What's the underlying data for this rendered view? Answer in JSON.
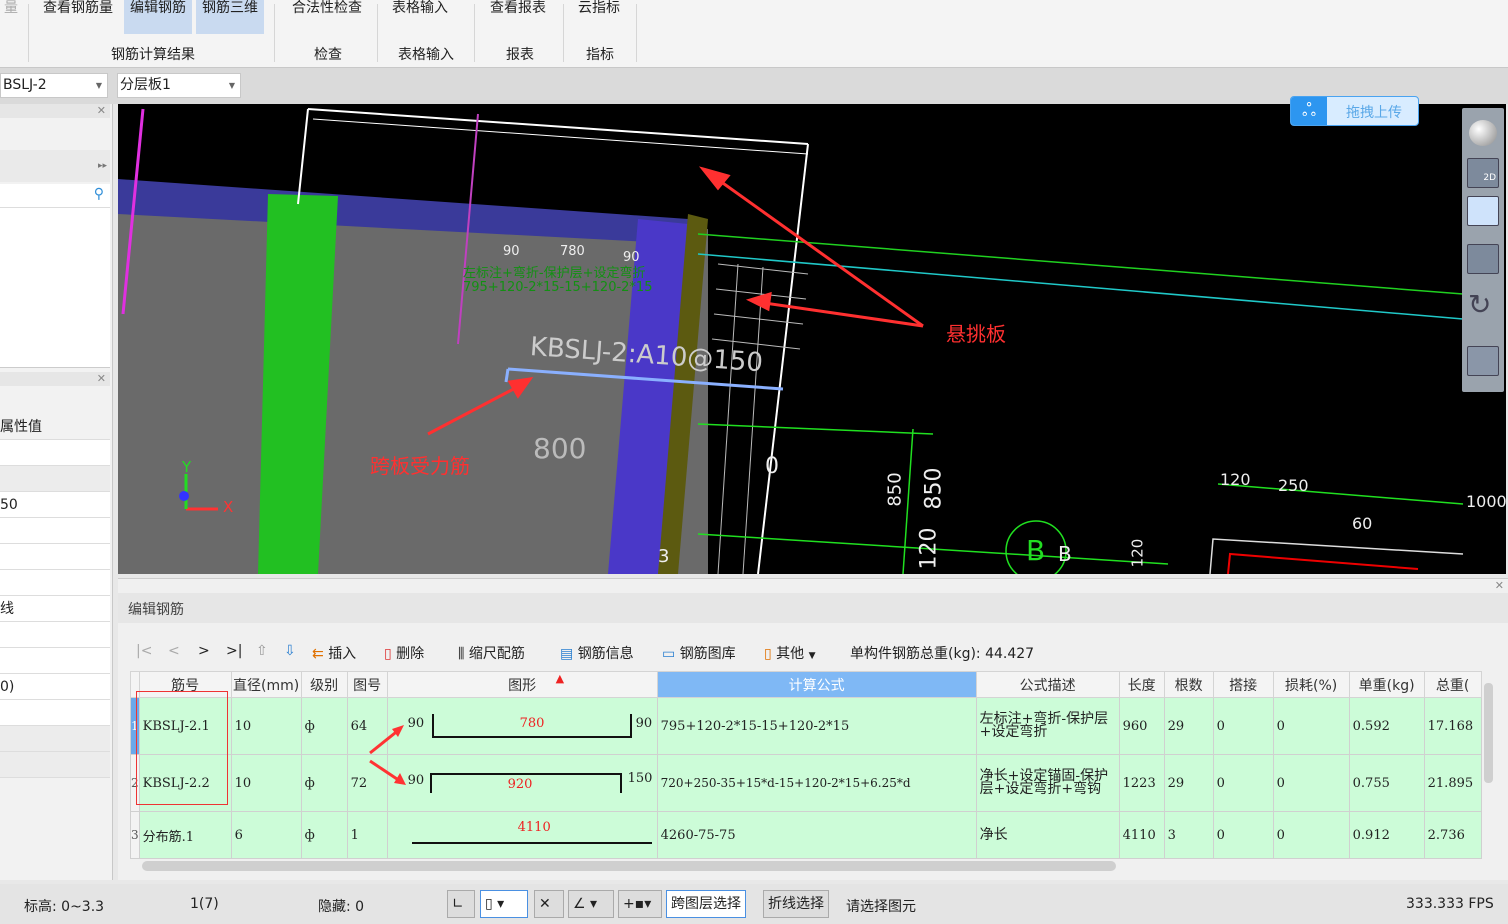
{
  "ribbon": {
    "buttons": [
      {
        "label": "量"
      },
      {
        "label": "查看钢筋量"
      },
      {
        "label": "编辑钢筋"
      },
      {
        "label": "钢筋三维"
      },
      {
        "label": "合法性检查"
      },
      {
        "label": "表格输入"
      },
      {
        "label": "查看报表"
      },
      {
        "label": "云指标"
      }
    ],
    "groups": [
      "钢筋计算结果",
      "检查",
      "表格输入",
      "报表",
      "指标"
    ]
  },
  "selectors": {
    "component": "BSLJ-2",
    "layer": "分层板1"
  },
  "left_panel": {
    "prop_header": "属性值",
    "values": [
      "50",
      "线",
      "0)"
    ]
  },
  "viewport": {
    "upload_label": "拖拽上传",
    "view_2d": "2D",
    "annot_cantilever": "悬挑板",
    "annot_span_bar": "跨板受力筋",
    "rebar_label": "KBSLJ-2:A10@150",
    "dim_800": "800",
    "dims_top": [
      "90",
      "780",
      "90"
    ],
    "green_formula1": "左标注+弯折-保护层+设定弯折",
    "green_formula2": "795+120-2*15-15+120-2*15",
    "dims_right": [
      "850",
      "850",
      "120",
      "120",
      "120",
      "250",
      "1000",
      "60"
    ],
    "axis_label": "B",
    "x_axis": "X",
    "y_axis": "Y",
    "num_0": "0",
    "num_3": "3"
  },
  "edit_panel": {
    "title": "编辑钢筋",
    "toolbar": {
      "first": "|<",
      "prev": "<",
      "next": ">",
      "last": ">|",
      "insert": "插入",
      "delete": "删除",
      "scale": "缩尺配筋",
      "info": "钢筋信息",
      "library": "钢筋图库",
      "other": "其他",
      "total_label": "单构件钢筋总重(kg):",
      "total_value": "44.427"
    },
    "columns": [
      "筋号",
      "直径(mm)",
      "级别",
      "图号",
      "图形",
      "计算公式",
      "公式描述",
      "长度",
      "根数",
      "搭接",
      "损耗(%)",
      "单重(kg)",
      "总重("
    ],
    "rows": [
      {
        "num": "1",
        "id": "KBSLJ-2.1",
        "dia": "10",
        "grade": "ф",
        "fig": "64",
        "left": "90",
        "mid": "780",
        "right": "90",
        "formula": "795+120-2*15-15+120-2*15",
        "desc": "左标注+弯折-保护层+设定弯折",
        "len": "960",
        "count": "29",
        "lap": "0",
        "loss": "0",
        "unit": "0.592",
        "total": "17.168"
      },
      {
        "num": "2",
        "id": "KBSLJ-2.2",
        "dia": "10",
        "grade": "ф",
        "fig": "72",
        "left": "90",
        "mid": "920",
        "right": "150",
        "formula": "720+250-35+15*d-15+120-2*15+6.25*d",
        "desc": "净长+设定锚固-保护层+设定弯折+弯钩",
        "len": "1223",
        "count": "29",
        "lap": "0",
        "loss": "0",
        "unit": "0.755",
        "total": "21.895"
      },
      {
        "num": "3",
        "id": "分布筋.1",
        "dia": "6",
        "grade": "ф",
        "fig": "1",
        "left": "",
        "mid": "4110",
        "right": "",
        "formula": "4260-75-75",
        "desc": "净长",
        "len": "4110",
        "count": "3",
        "lap": "0",
        "loss": "0",
        "unit": "0.912",
        "total": "2.736"
      }
    ]
  },
  "status": {
    "elevation": "标高:  0~3.3",
    "floor": "1(7)",
    "hidden": "隐藏:  0",
    "cross_layer": "跨图层选择",
    "polyline": "折线选择",
    "prompt": "请选择图元",
    "fps": "333.333 FPS"
  },
  "colors": {
    "grid_row": "#ccfcd8",
    "header_active": "#7fb8f5",
    "annotation": "#ff3030"
  }
}
